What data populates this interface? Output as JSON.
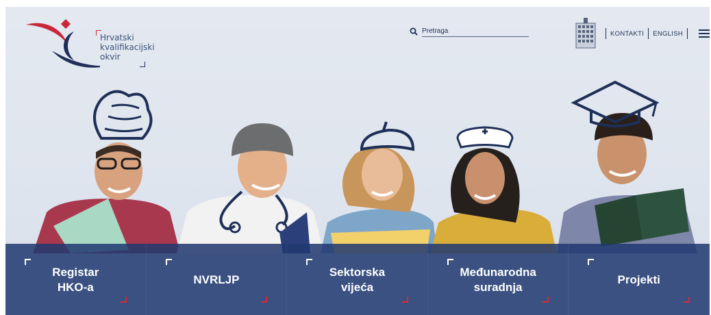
{
  "logo": {
    "lines": [
      "Hrvatski",
      "kvalifikacijski",
      "okvir"
    ]
  },
  "search": {
    "placeholder": "Pretraga"
  },
  "topnav": {
    "contacts": "KONTAKTI",
    "english": "ENGLISH"
  },
  "tiles": [
    {
      "label": "Registar\nHKO-a"
    },
    {
      "label": "NVRLJP"
    },
    {
      "label": "Sektorska\nvijeća"
    },
    {
      "label": "Međunarodna\nsuradnja"
    },
    {
      "label": "Projekti"
    }
  ],
  "colors": {
    "navy": "#1e2f58",
    "tile": "#213970",
    "red": "#d8283a"
  }
}
